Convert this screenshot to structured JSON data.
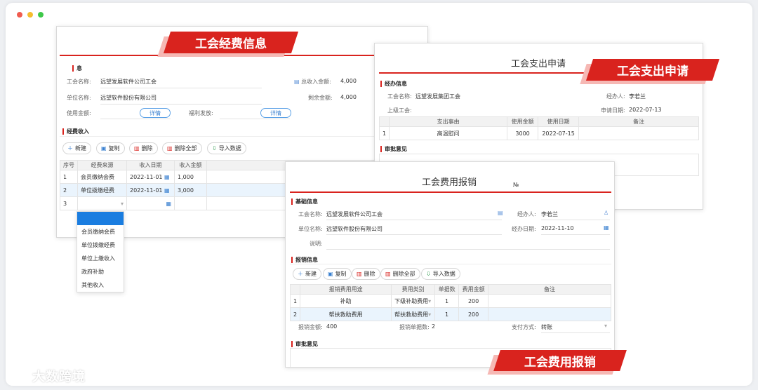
{
  "window": {
    "dots": [
      "#f05b4f",
      "#f5bd2e",
      "#3ec84a"
    ]
  },
  "funds": {
    "banner": "工会经费信息",
    "section_info": "息",
    "union_name_label": "工会名称:",
    "union_name": "远望发展软件公司工会",
    "unit_name_label": "单位名称:",
    "unit_name": "远望软件股份有限公司",
    "total_income_label": "总收入金额:",
    "total_income": "4,000",
    "remaining_label": "剩余金额:",
    "remaining": "4,000",
    "use_amount_label": "使用金额:",
    "welfare_label": "福利发放:",
    "detail1": "详情",
    "detail2": "详情",
    "section_income": "经费收入",
    "buttons": [
      "新建",
      "复制",
      "删除",
      "删除全部",
      "导入数据"
    ],
    "columns": [
      "序号",
      "经费来源",
      "收入日期",
      "收入金额"
    ],
    "rows": [
      [
        "1",
        "会员缴纳会费",
        "2022-11-01",
        "1,000"
      ],
      [
        "2",
        "单位拨缴经费",
        "2022-11-01",
        "3,000"
      ],
      [
        "3",
        "",
        "",
        ""
      ]
    ],
    "dropdown": [
      "会员缴纳会费",
      "单位拨缴经费",
      "单位上缴收入",
      "政府补助",
      "其他收入"
    ]
  },
  "expense": {
    "title": "工会支出申请",
    "banner": "工会支出申请",
    "section_handle": "经办信息",
    "union_label": "工会名称:",
    "union": "远望发展集团工会",
    "handler_label": "经办人:",
    "handler": "李若兰",
    "superior_label": "上级工会:",
    "date_label": "申请日期:",
    "date": "2022-07-13",
    "columns": [
      "",
      "支出事由",
      "使用金额",
      "使用日期",
      "备注"
    ],
    "rows": [
      [
        "1",
        "高温慰问",
        "3000",
        "2022-07-15",
        ""
      ]
    ],
    "section_approval": "审批意见"
  },
  "reimb": {
    "title": "工会费用报销",
    "no_label": "№",
    "banner": "工会费用报销",
    "section_basic": "基础信息",
    "union_label": "工会名称:",
    "union": "远望发展软件公司工会",
    "handler_label": "经办人:",
    "handler": "李若兰",
    "unit_label": "单位名称:",
    "unit": "远望软件股份有限公司",
    "date_label": "经办日期:",
    "date": "2022-11-10",
    "note_label": "说明:",
    "section_reimb": "报销信息",
    "buttons": [
      "新建",
      "复制",
      "删除",
      "删除全部",
      "导入数据"
    ],
    "columns": [
      "",
      "报销费用用途",
      "费用类别",
      "单据数",
      "费用金额",
      "备注"
    ],
    "rows": [
      [
        "1",
        "补助",
        "下级补助费用",
        "1",
        "200",
        ""
      ],
      [
        "2",
        "帮扶救助费用",
        "帮扶救助费用",
        "1",
        "200",
        ""
      ]
    ],
    "amount_label": "报销金额:",
    "amount": "400",
    "count_label": "报销单据数:",
    "count": "2",
    "pay_label": "支付方式:",
    "pay": "转账",
    "section_approval": "审批意见"
  },
  "watermark": "大数跨境"
}
